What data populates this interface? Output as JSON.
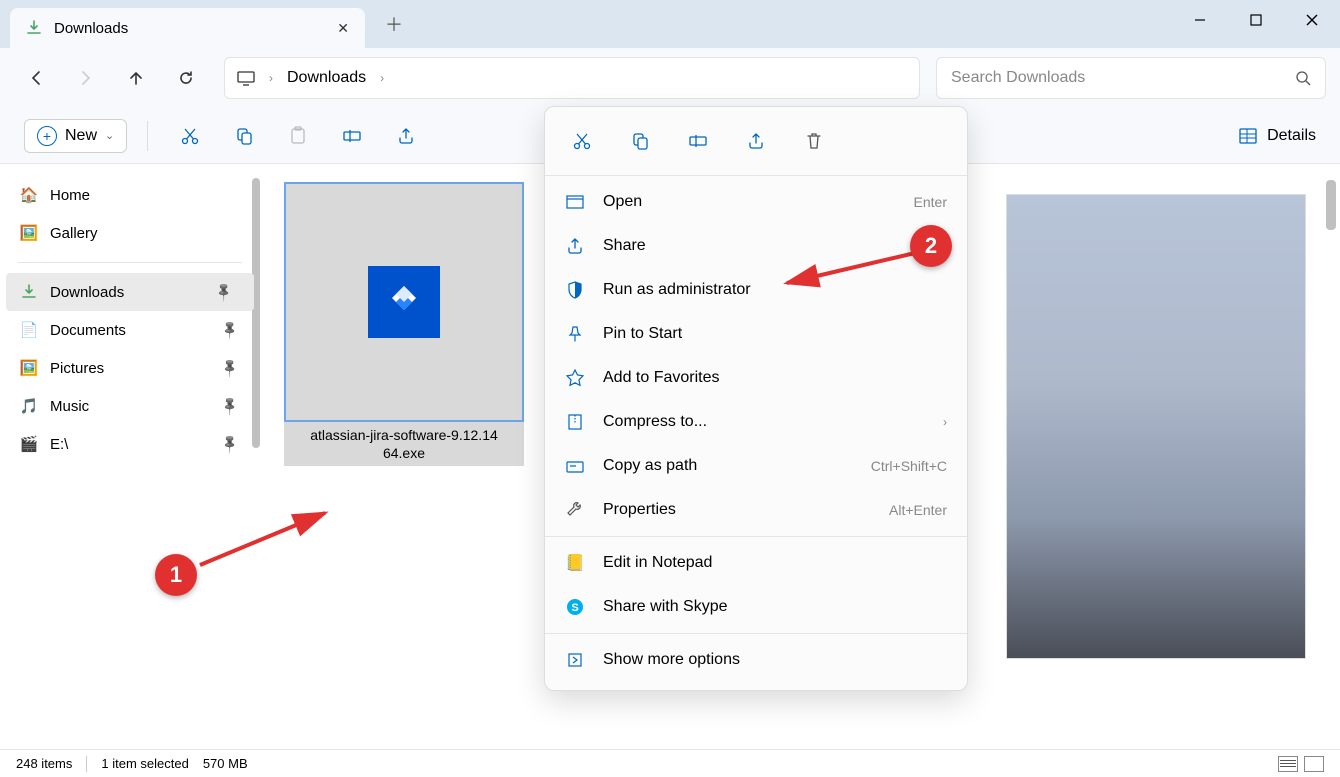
{
  "tab": {
    "title": "Downloads"
  },
  "breadcrumb": {
    "location": "Downloads"
  },
  "search": {
    "placeholder": "Search Downloads"
  },
  "toolbar": {
    "new_label": "New",
    "details_label": "Details"
  },
  "sidebar": {
    "home": "Home",
    "gallery": "Gallery",
    "downloads": "Downloads",
    "documents": "Documents",
    "pictures": "Pictures",
    "music": "Music",
    "edrive": "E:\\"
  },
  "file": {
    "name_line1": "atlassian-jira-software-9.12.14",
    "name_line2": "64.exe"
  },
  "context_menu": {
    "open": {
      "label": "Open",
      "shortcut": "Enter"
    },
    "share": {
      "label": "Share"
    },
    "runadmin": {
      "label": "Run as administrator"
    },
    "pinstart": {
      "label": "Pin to Start"
    },
    "favorites": {
      "label": "Add to Favorites"
    },
    "compress": {
      "label": "Compress to..."
    },
    "copypath": {
      "label": "Copy as path",
      "shortcut": "Ctrl+Shift+C"
    },
    "properties": {
      "label": "Properties",
      "shortcut": "Alt+Enter"
    },
    "notepad": {
      "label": "Edit in Notepad"
    },
    "skype": {
      "label": "Share with Skype"
    },
    "more": {
      "label": "Show more options"
    }
  },
  "status": {
    "items": "248 items",
    "selected": "1 item selected",
    "size": "570 MB"
  },
  "annotations": {
    "badge1": "1",
    "badge2": "2"
  }
}
